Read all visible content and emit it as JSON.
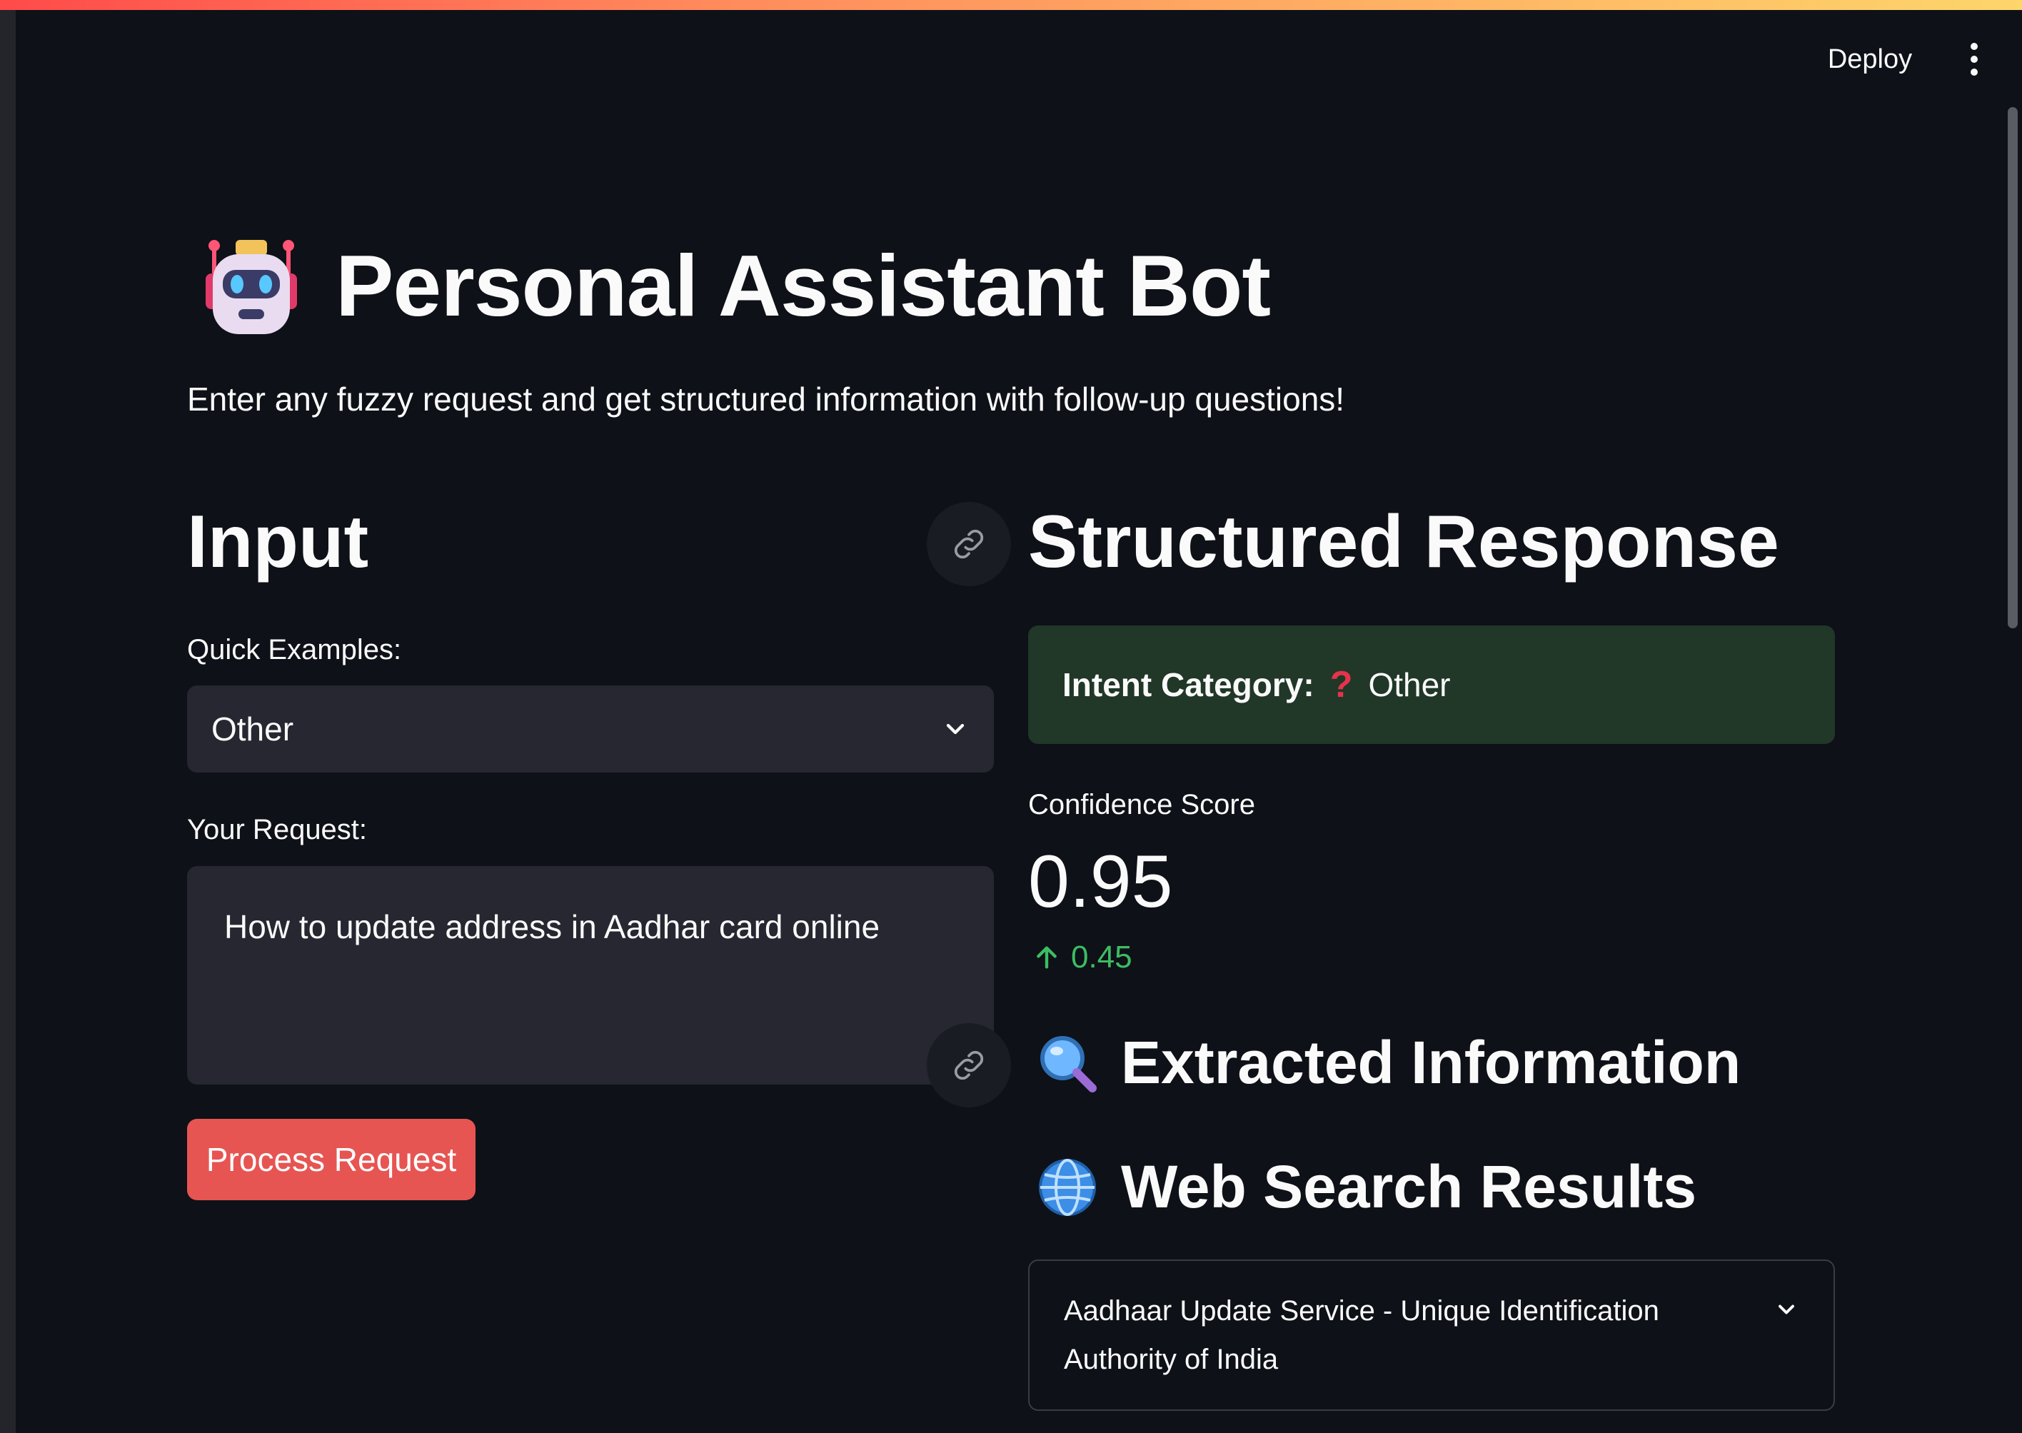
{
  "header": {
    "deploy_label": "Deploy",
    "menu_icon": "vertical-ellipsis-icon"
  },
  "page": {
    "title": "Personal Assistant Bot",
    "title_icon": "robot-icon",
    "subtitle": "Enter any fuzzy request and get structured information with follow-up questions!"
  },
  "input": {
    "heading": "Input",
    "quick_examples_label": "Quick Examples:",
    "quick_examples_selected": "Other",
    "request_label": "Your Request:",
    "request_value": "How to update address in Aadhar card online",
    "process_button_label": "Process Request"
  },
  "response": {
    "heading": "Structured Response",
    "intent_label": "Intent Category:",
    "intent_icon": "question-mark-icon",
    "intent_value": "Other",
    "confidence_label": "Confidence Score",
    "confidence_value": "0.95",
    "confidence_delta": "0.45",
    "extracted_heading": "Extracted Information",
    "extracted_icon": "magnifier-icon",
    "web_search_heading": "Web Search Results",
    "web_search_icon": "globe-icon",
    "web_results": [
      {
        "title": "Aadhaar Update Service - Unique Identification Authority of India"
      }
    ]
  },
  "colors": {
    "background": "#0e1117",
    "widget": "#262730",
    "primary_button": "#e65552",
    "success_box": "#213728",
    "delta_positive": "#3dbc63"
  }
}
